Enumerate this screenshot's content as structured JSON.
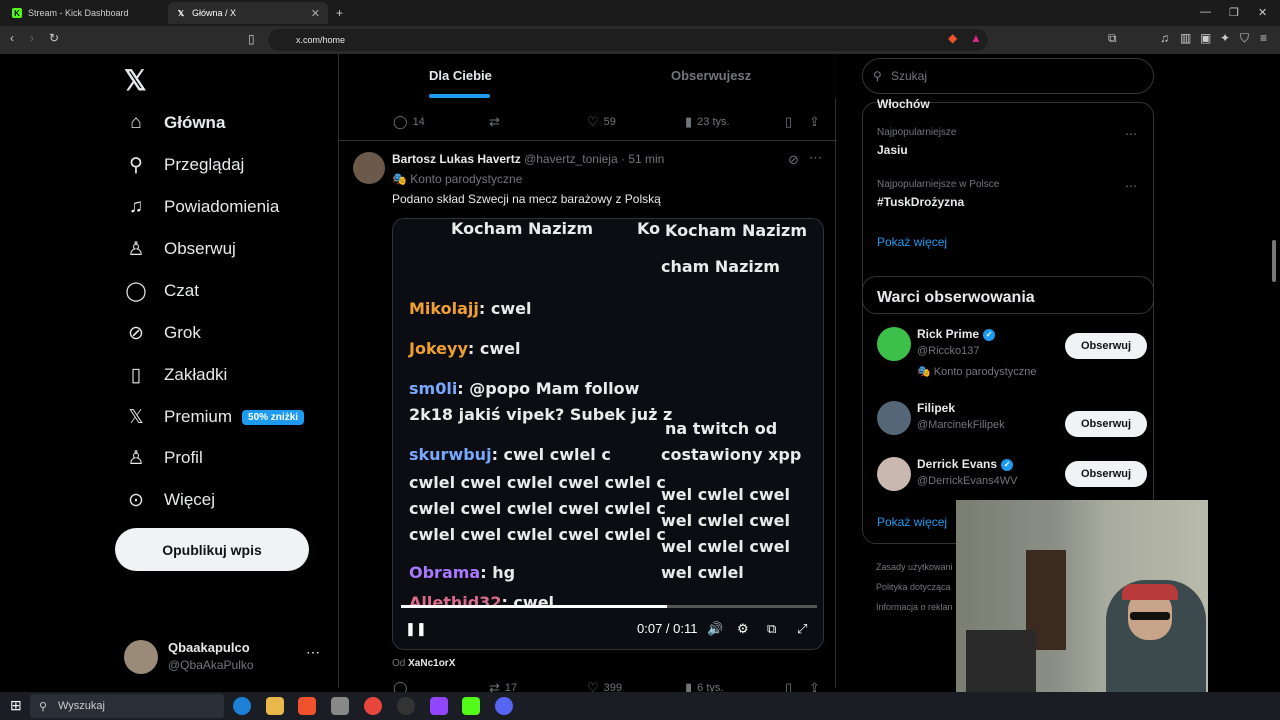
{
  "browser": {
    "tabs": [
      {
        "title": "Stream - Kick Dashboard",
        "icon": "kick-icon"
      },
      {
        "title": "Główna / X",
        "icon": "x-icon"
      }
    ],
    "url": "x.com/home"
  },
  "sidebar": {
    "items": [
      {
        "label": "Główna",
        "icon": "home-icon",
        "glyph": "⌂"
      },
      {
        "label": "Przeglądaj",
        "icon": "search-icon",
        "glyph": "⌕"
      },
      {
        "label": "Powiadomienia",
        "icon": "bell-icon",
        "glyph": "🔔"
      },
      {
        "label": "Obserwuj",
        "icon": "add-person-icon",
        "glyph": "👤"
      },
      {
        "label": "Czat",
        "icon": "chat-icon",
        "glyph": "💬"
      },
      {
        "label": "Grok",
        "icon": "grok-icon",
        "glyph": "⊘"
      },
      {
        "label": "Zakładki",
        "icon": "bookmark-icon",
        "glyph": "🔖"
      },
      {
        "label": "Premium",
        "icon": "x-icon",
        "glyph": "𝕏"
      },
      {
        "label": "Profil",
        "icon": "profile-icon",
        "glyph": "👤"
      },
      {
        "label": "Więcej",
        "icon": "more-circle-icon",
        "glyph": "⋯"
      }
    ],
    "premium_badge": "50% zniżki",
    "post_button": "Opublikuj wpis",
    "account": {
      "name": "Qbaakapulco",
      "handle": "@QbaAkaPulko"
    }
  },
  "feed": {
    "tabs": [
      "Dla Ciebie",
      "Obserwujesz"
    ],
    "prev_actions": {
      "replies": "14",
      "likes": "59",
      "views": "23 tys."
    },
    "tweet": {
      "name": "Bartosz Lukas Havertz",
      "handle": "@havertz_tonieja",
      "time": "51 min",
      "parody": "Konto parodystyczne",
      "text": "Podano skład Szwecji na mecz barażowy z Polską",
      "video_time": "0:07 / 0:11",
      "from_label": "Od",
      "from_user": "XaNc1orX",
      "actions": {
        "retweets": "17",
        "likes": "399",
        "views": "6 tys."
      }
    },
    "chat_lines": [
      {
        "user": "",
        "text": "Kocham Nazizm"
      },
      {
        "user": "",
        "text": "Ko"
      },
      {
        "user": "",
        "text": "Kocham Nazizm"
      },
      {
        "user": "",
        "text": "cham Nazizm"
      },
      {
        "user": "Mikolajj",
        "text": ": cwel"
      },
      {
        "user": "Jokeyy",
        "text": ": cwel"
      },
      {
        "user": "sm0li",
        "text": ": @popo Mam follow"
      },
      {
        "user": "",
        "text": "2k18 jakiś vipek? Subek już z"
      },
      {
        "user": "",
        "text": "na twitch od"
      },
      {
        "user": "skurwbuj",
        "text": ": cwel cwlel c"
      },
      {
        "user": "",
        "text": "costawiony xpp"
      },
      {
        "user": "",
        "text": "cwlel cwel cwlel cwel cwlel c"
      },
      {
        "user": "",
        "text": "wel cwlel cwel"
      },
      {
        "user": "",
        "text": "cwlel cwel cwlel cwel cwlel c"
      },
      {
        "user": "",
        "text": "wel cwlel cwel"
      },
      {
        "user": "",
        "text": "cwlel cwel cwlel cwel cwlel c"
      },
      {
        "user": "",
        "text": "wel cwlel cwel"
      },
      {
        "user": "Obrama",
        "text": ": hg"
      },
      {
        "user": "",
        "text": "wel cwlel"
      },
      {
        "user": "Allethid32",
        "text": ": cwel"
      }
    ],
    "video_progress": 0.64
  },
  "right": {
    "search_placeholder": "Szukaj",
    "trends": [
      {
        "category": "",
        "name": "Włochów"
      },
      {
        "category": "Najpopularniejsze",
        "name": "Jasiu"
      },
      {
        "category": "Najpopularniejsze w Polsce",
        "name": "#TuskDrożyzna"
      }
    ],
    "show_more": "Pokaż więcej",
    "who_to_follow_title": "Warci obserwowania",
    "users": [
      {
        "name": "Rick Prime",
        "handle": "@Riccko137",
        "extra": "Konto parodystyczne",
        "verified": true,
        "color": "#3cc04a"
      },
      {
        "name": "Filipek",
        "handle": "@MarcinekFilipek",
        "extra": "",
        "verified": false,
        "color": "#556677"
      },
      {
        "name": "Derrick Evans",
        "handle": "@DerrickEvans4WV",
        "extra": "",
        "verified": true,
        "color": "#c9b8b0"
      }
    ],
    "follow_label": "Obserwuj",
    "show_more2": "Pokaż więcej",
    "footer": [
      "Zasady użytkowani",
      "Polityka dotycząca",
      "Informacja o reklan"
    ]
  },
  "taskbar": {
    "search": "Wyszukaj"
  }
}
